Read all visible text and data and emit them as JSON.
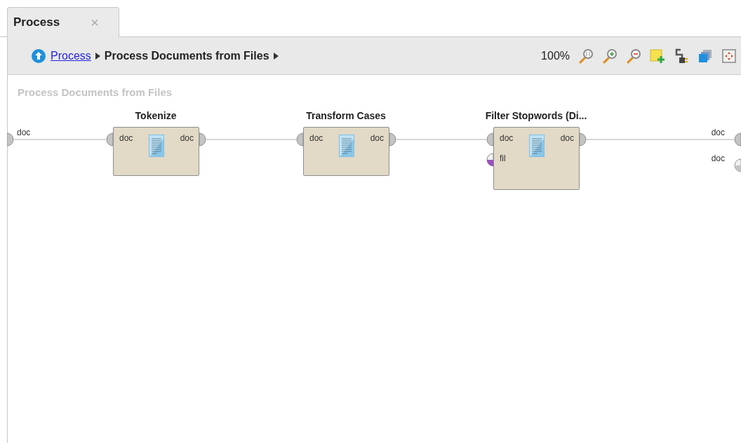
{
  "tabs": [
    {
      "label": "Process",
      "selected": true,
      "close": "×"
    }
  ],
  "breadcrumb": {
    "link": "Process",
    "current": "Process Documents from Files"
  },
  "toolbar": {
    "zoom": "100%"
  },
  "canvas": {
    "title": "Process Documents from Files",
    "inputs": [
      {
        "label": "doc",
        "kind": "full",
        "color": "#c4c4c4"
      }
    ],
    "outputs": [
      {
        "label": "doc",
        "kind": "full",
        "color": "#c4c4c4"
      },
      {
        "label": "doc",
        "kind": "half",
        "color": "#c4c4c4"
      }
    ],
    "operators": [
      {
        "title": "Tokenize",
        "inputs": [
          {
            "label": "doc",
            "kind": "full",
            "color": "#c4c4c4"
          }
        ],
        "outputs": [
          {
            "label": "doc",
            "kind": "full",
            "color": "#c4c4c4"
          }
        ]
      },
      {
        "title": "Transform Cases",
        "inputs": [
          {
            "label": "doc",
            "kind": "full",
            "color": "#c4c4c4"
          }
        ],
        "outputs": [
          {
            "label": "doc",
            "kind": "full",
            "color": "#c4c4c4"
          }
        ]
      },
      {
        "title": "Filter Stopwords (Di...",
        "inputs": [
          {
            "label": "doc",
            "kind": "full",
            "color": "#c4c4c4"
          },
          {
            "label": "fil",
            "kind": "half",
            "color": "#9b4fc0"
          }
        ],
        "outputs": [
          {
            "label": "doc",
            "kind": "full",
            "color": "#c4c4c4"
          }
        ]
      }
    ]
  }
}
